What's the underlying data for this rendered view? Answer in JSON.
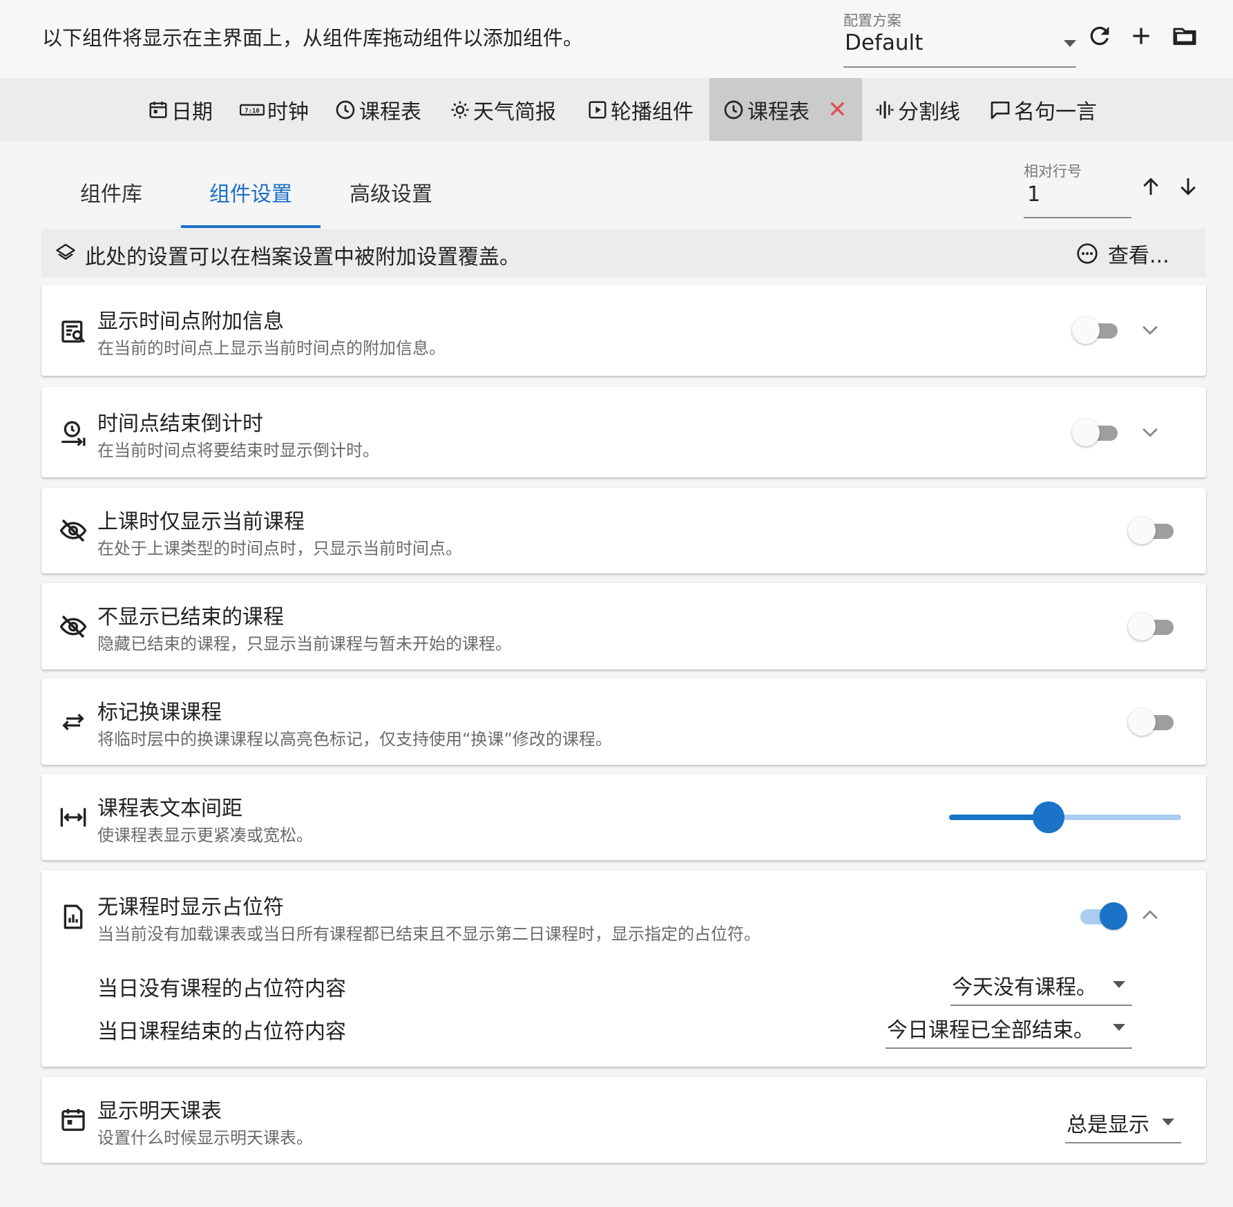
{
  "header": {
    "hint": "以下组件将显示在主界面上，从组件库拖动组件以添加组件。",
    "profile_label": "配置方案",
    "profile_value": "Default"
  },
  "components": [
    {
      "label": "日期",
      "icon": "calendar-icon"
    },
    {
      "label": "时钟",
      "icon": "digital-clock-icon"
    },
    {
      "label": "课程表",
      "icon": "clock-icon"
    },
    {
      "label": "天气简报",
      "icon": "sun-icon"
    },
    {
      "label": "轮播组件",
      "icon": "play-box-icon"
    },
    {
      "label": "课程表",
      "icon": "clock-icon",
      "selected": true,
      "remove_glyph": "✕"
    },
    {
      "label": "分割线",
      "icon": "separator-icon"
    },
    {
      "label": "名句一言",
      "icon": "comment-icon"
    }
  ],
  "tabs": [
    {
      "label": "组件库",
      "active": false
    },
    {
      "label": "组件设置",
      "active": true
    },
    {
      "label": "高级设置",
      "active": false
    }
  ],
  "row_number": {
    "label": "相对行号",
    "value": "1"
  },
  "info_bar": {
    "text": "此处的设置可以在档案设置中被附加设置覆盖。",
    "view_label": "查看..."
  },
  "settings": [
    {
      "title": "显示时间点附加信息",
      "desc": "在当前的时间点上显示当前时间点的附加信息。",
      "icon": "text-search-icon",
      "enabled": false,
      "expandable": true
    },
    {
      "title": "时间点结束倒计时",
      "desc": "在当前时间点将要结束时显示倒计时。",
      "icon": "timer-end-icon",
      "enabled": false,
      "expandable": true
    },
    {
      "title": "上课时仅显示当前课程",
      "desc": "在处于上课类型的时间点时，只显示当前时间点。",
      "icon": "eye-off-icon",
      "enabled": false
    },
    {
      "title": "不显示已结束的课程",
      "desc": "隐藏已结束的课程，只显示当前课程与暂未开始的课程。",
      "icon": "eye-off-icon",
      "enabled": false
    },
    {
      "title": "标记换课课程",
      "desc": "将临时层中的换课课程以高亮色标记，仅支持使用“换课”修改的课程。",
      "icon": "swap-icon",
      "enabled": false
    },
    {
      "title": "课程表文本间距",
      "desc": "使课程表显示更紧凑或宽松。",
      "icon": "spacing-icon",
      "slider_value": 0.43
    },
    {
      "title": "无课程时显示占位符",
      "desc": "当当前没有加载课表或当日所有课程都已结束且不显示第二日课程时，显示指定的占位符。",
      "icon": "chart-doc-icon",
      "enabled": true,
      "expanded": true,
      "sub_options": [
        {
          "label": "当日没有课程的占位符内容",
          "value": "今天没有课程。"
        },
        {
          "label": "当日课程结束的占位符内容",
          "value": "今日课程已全部结束。"
        }
      ]
    },
    {
      "title": "显示明天课表",
      "desc": "设置什么时候显示明天课表。",
      "icon": "calendar-icon",
      "dropdown_value": "总是显示"
    }
  ],
  "colors": {
    "accent": "#1a73c6",
    "remove": "#e05050"
  }
}
